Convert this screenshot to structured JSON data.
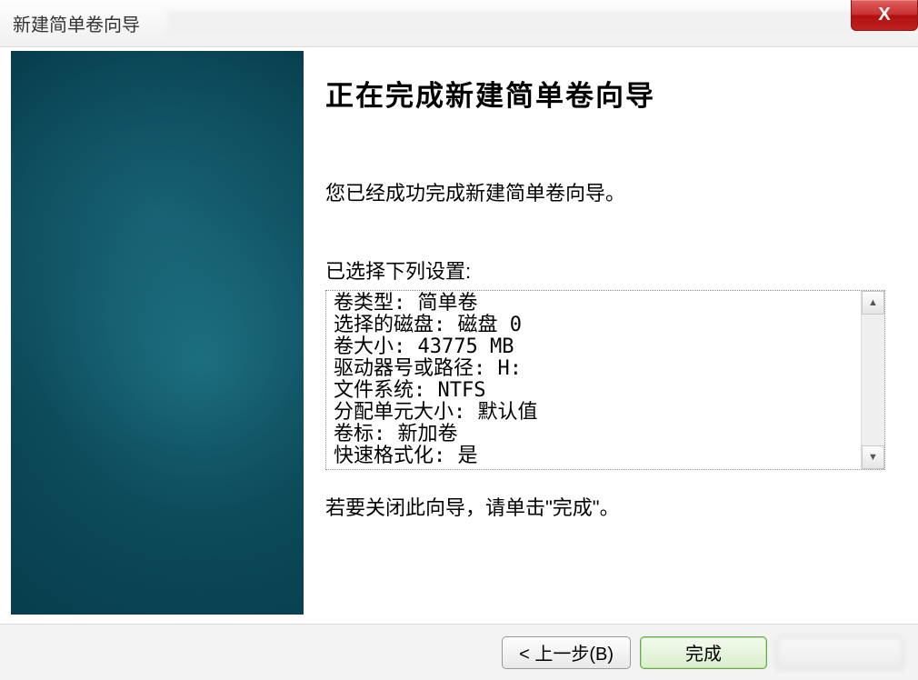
{
  "window": {
    "title": "新建简单卷向导"
  },
  "wizard": {
    "heading": "正在完成新建简单卷向导",
    "intro": "您已经成功完成新建简单卷向导。",
    "settings_label": "已选择下列设置:",
    "closing": "若要关闭此向导，请单击\"完成\"。"
  },
  "settings": {
    "lines": [
      "卷类型: 简单卷",
      "选择的磁盘: 磁盘 0",
      "卷大小: 43775 MB",
      "驱动器号或路径: H:",
      "文件系统: NTFS",
      "分配单元大小: 默认值",
      "卷标: 新加卷",
      "快速格式化: 是"
    ]
  },
  "buttons": {
    "back": "< 上一步(B)",
    "finish": "完成"
  },
  "icons": {
    "close": "X",
    "up": "▲",
    "down": "▼"
  }
}
